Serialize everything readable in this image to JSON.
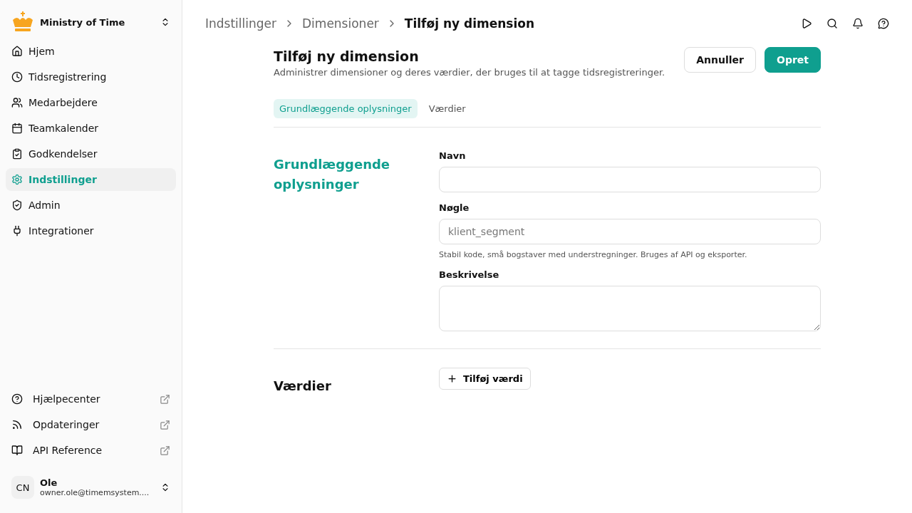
{
  "org": {
    "name": "Ministry of Time"
  },
  "nav": [
    {
      "label": "Hjem",
      "selected": false
    },
    {
      "label": "Tidsregistrering",
      "selected": false
    },
    {
      "label": "Medarbejdere",
      "selected": false
    },
    {
      "label": "Teamkalender",
      "selected": false
    },
    {
      "label": "Godkendelser",
      "selected": false
    },
    {
      "label": "Indstillinger",
      "selected": true
    },
    {
      "label": "Admin",
      "selected": false
    },
    {
      "label": "Integrationer",
      "selected": false
    }
  ],
  "links": [
    {
      "label": "Hjælpecenter"
    },
    {
      "label": "Opdateringer"
    },
    {
      "label": "API Reference"
    }
  ],
  "user": {
    "initials": "CN",
    "name": "Ole",
    "email": "owner.ole@timemsystem...."
  },
  "breadcrumbs": [
    "Indstillinger",
    "Dimensioner",
    "Tilføj ny dimension"
  ],
  "page": {
    "title": "Tilføj ny dimension",
    "subtitle": "Administrer dimensioner og deres værdier, der bruges til at tagge tidsregistreringer.",
    "cancel": "Annuller",
    "create": "Opret"
  },
  "tabs": [
    {
      "label": "Grundlæggende oplysninger",
      "selected": true
    },
    {
      "label": "Værdier",
      "selected": false
    }
  ],
  "basic": {
    "heading": "Grundlæggende oplysninger",
    "fields": [
      {
        "kind": "input",
        "label": "Navn"
      },
      {
        "kind": "input",
        "label": "Nøgle",
        "placeholder": "klient_segment",
        "hint": "Stabil kode, små bogstaver med understregninger. Bruges af API og eksporter."
      },
      {
        "kind": "textarea",
        "label": "Beskrivelse"
      }
    ]
  },
  "values": {
    "heading": "Værdier",
    "add": "Tilføj værdi"
  }
}
